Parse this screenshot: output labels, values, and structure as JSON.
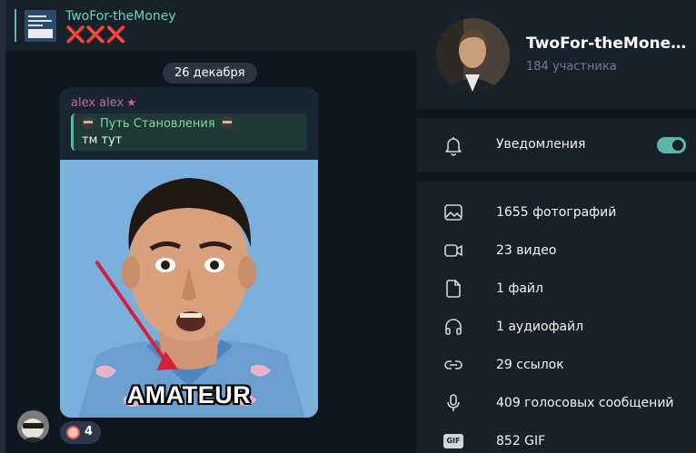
{
  "pinned": {
    "title": "TwoFor-theMoney",
    "marks": "❌❌❌"
  },
  "chat": {
    "date": "26 декабря",
    "message": {
      "sender": "alex alex",
      "sender_badge": "★",
      "reply_to": {
        "title": "Путь Становления",
        "text": "тм тут"
      },
      "media_caption": "AMATEUR",
      "reaction_count": "4"
    }
  },
  "panel": {
    "group_name": "TwoFor-theMoney ...",
    "members": "184 участника",
    "notifications": {
      "label": "Уведомления",
      "enabled": true
    },
    "media": [
      {
        "icon": "photo-icon",
        "label": "1655 фотографий"
      },
      {
        "icon": "video-icon",
        "label": "23 видео"
      },
      {
        "icon": "file-icon",
        "label": "1 файл"
      },
      {
        "icon": "headphones-icon",
        "label": "1 аудиофайл"
      },
      {
        "icon": "link-icon",
        "label": "29 ссылок"
      },
      {
        "icon": "microphone-icon",
        "label": "409 голосовых сообщений"
      },
      {
        "icon": "gif-icon",
        "label": "852 GIF",
        "badge": "GIF"
      }
    ]
  },
  "colors": {
    "accent": "#5eb5a8",
    "sender_name": "#c86b9a",
    "reply_title": "#7ed8a2",
    "chat_bg": "#0e1621",
    "panel_bg": "#17212b"
  }
}
